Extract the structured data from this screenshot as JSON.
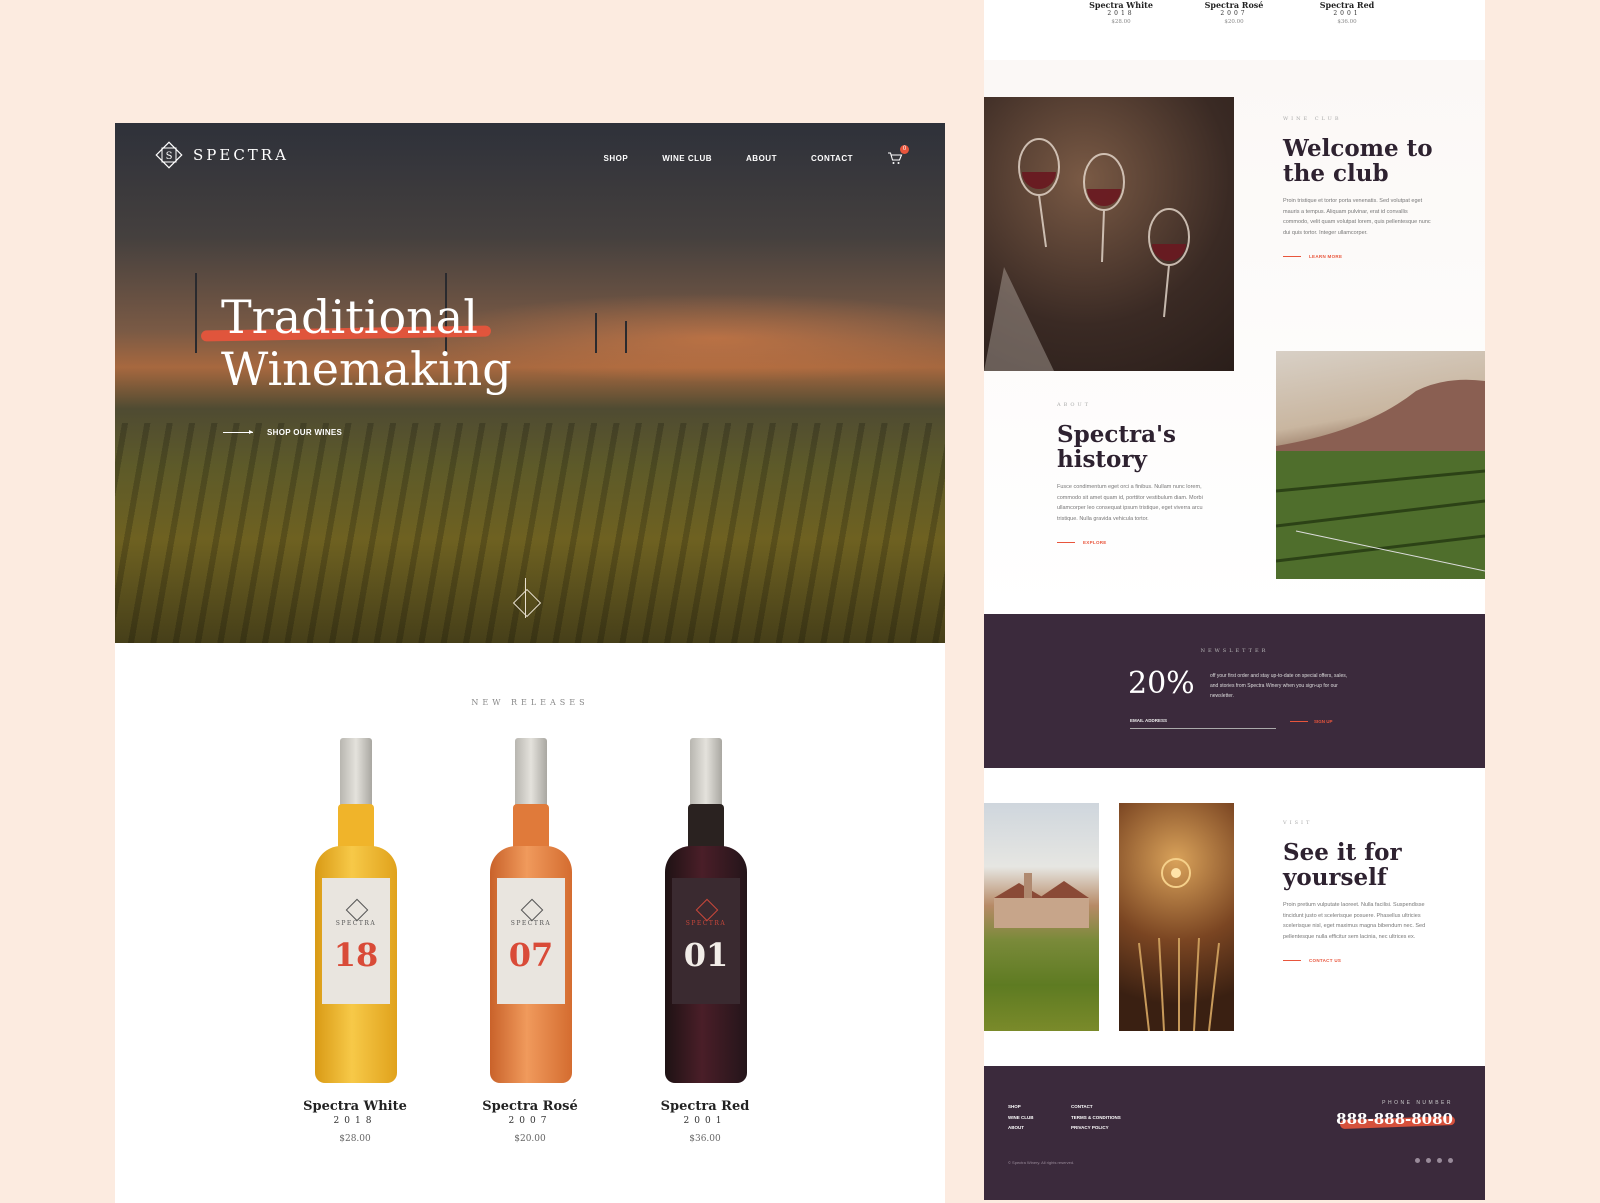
{
  "brand": {
    "name": "SPECTRA"
  },
  "nav": {
    "items": [
      "SHOP",
      "WINE CLUB",
      "ABOUT",
      "CONTACT"
    ],
    "cart_count": "0"
  },
  "hero": {
    "title_line1": "Traditional",
    "title_line2": "Winemaking",
    "cta": "SHOP OUR WINES"
  },
  "new_releases": {
    "title": "NEW RELEASES",
    "products": [
      {
        "name": "Spectra White",
        "year": "2018",
        "price": "$28.00",
        "label_brand": "SPECTRA",
        "label_number": "18",
        "color": "#f0b42a"
      },
      {
        "name": "Spectra Rosé",
        "year": "2007",
        "price": "$20.00",
        "label_brand": "SPECTRA",
        "label_number": "07",
        "color": "#e07a3a"
      },
      {
        "name": "Spectra Red",
        "year": "2001",
        "price": "$36.00",
        "label_brand": "SPECTRA",
        "label_number": "01",
        "color": "#3a1a22"
      }
    ]
  },
  "welcome": {
    "eyebrow": "WINE CLUB",
    "title": "Welcome to the club",
    "body": "Proin tristique et tortor porta venenatis. Sed volutpat eget mauris a tempus. Aliquam pulvinar, erat id convallis commodo, velit quam volutpat lorem, quis pellentesque nunc dui quis tortor. Integer ullamcorper.",
    "cta": "LEARN MORE"
  },
  "history": {
    "eyebrow": "ABOUT",
    "title": "Spectra's history",
    "body": "Fusce condimentum eget orci a finibus. Nullam nunc lorem, commodo sit amet quam id, porttitor vestibulum diam. Morbi ullamcorper leo consequat ipsum tristique, eget viverra arcu tristique. Nulla gravida vehicula tortor.",
    "cta": "EXPLORE"
  },
  "newsletter": {
    "eyebrow": "NEWSLETTER",
    "discount": "20%",
    "description": "off your first order and stay up-to-date on special offers, sales, and stories from Spectra Winery when you sign-up for our newsletter.",
    "email_placeholder": "EMAIL ADDRESS",
    "signup": "SIGN UP"
  },
  "visit": {
    "eyebrow": "VISIT",
    "title": "See it for yourself",
    "body": "Proin pretium vulputate laoreet. Nulla facilisi. Suspendisse tincidunt justo et scelerisque posuere. Phasellus ultricies scelerisque nisl, eget maximus magna bibendum nec. Sed pellentesque nulla efficitur sem lacinia, nec ultrices ex.",
    "cta": "CONTACT US"
  },
  "footer": {
    "col1": [
      "SHOP",
      "WINE CLUB",
      "ABOUT"
    ],
    "col2": [
      "CONTACT",
      "TERMS & CONDITIONS",
      "PRIVACY POLICY"
    ],
    "phone_label": "PHONE NUMBER",
    "phone": "888-888-8080",
    "copyright": "© Spectra Winery. All rights reserved."
  },
  "accent_color": "#e8553c",
  "dark_color": "#3b2a3c"
}
